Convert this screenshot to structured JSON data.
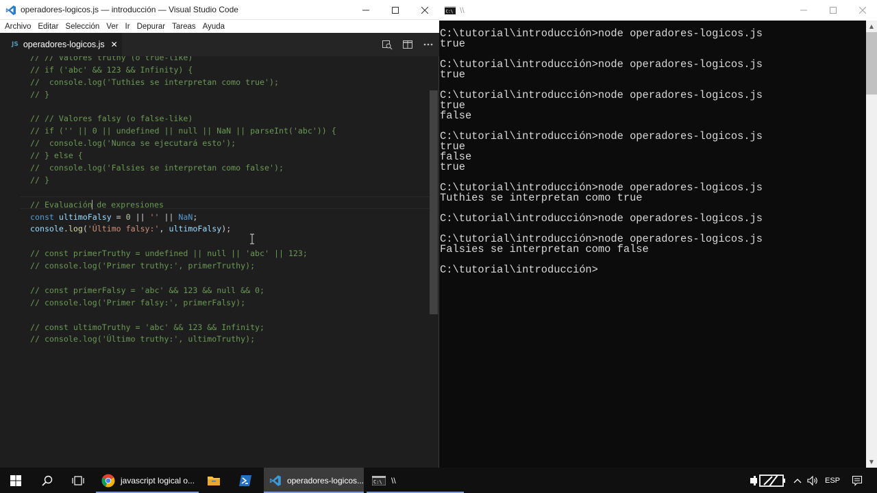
{
  "vscode": {
    "title": "operadores-logicos.js — introducción — Visual Studio Code",
    "menu": [
      "Archivo",
      "Editar",
      "Selección",
      "Ver",
      "Ir",
      "Depurar",
      "Tareas",
      "Ayuda"
    ],
    "tab": {
      "lang": "JS",
      "label": "operadores-logicos.js",
      "close": "✕"
    },
    "code": [
      {
        "t": [
          [
            "cm",
            "// // Valores truthy (o true-like)"
          ]
        ]
      },
      {
        "t": [
          [
            "cm",
            "// if ('abc' && 123 && Infinity) {"
          ]
        ]
      },
      {
        "t": [
          [
            "cm",
            "//  console.log('Tuthies se interpretan como true');"
          ]
        ]
      },
      {
        "t": [
          [
            "cm",
            "// }"
          ]
        ]
      },
      {
        "t": []
      },
      {
        "t": [
          [
            "cm",
            "// // Valores falsy (o false-like)"
          ]
        ]
      },
      {
        "t": [
          [
            "cm",
            "// if ('' || 0 || undefined || null || NaN || parseInt('abc')) {"
          ]
        ]
      },
      {
        "t": [
          [
            "cm",
            "//  console.log('Nunca se ejecutará esto');"
          ]
        ]
      },
      {
        "t": [
          [
            "cm",
            "// } else {"
          ]
        ]
      },
      {
        "t": [
          [
            "cm",
            "//  console.log('Falsies se interpretan como false');"
          ]
        ]
      },
      {
        "t": [
          [
            "cm",
            "// }"
          ]
        ]
      },
      {
        "t": []
      },
      {
        "t": [
          [
            "cm",
            "// Evaluación"
          ],
          [
            "cursor",
            ""
          ],
          [
            "cm",
            " de expresiones"
          ]
        ]
      },
      {
        "t": [
          [
            "kw",
            "const"
          ],
          [
            "pl",
            " "
          ],
          [
            "vr",
            "ultimoFalsy"
          ],
          [
            "pl",
            " = "
          ],
          [
            "nm",
            "0"
          ],
          [
            "pl",
            " || "
          ],
          [
            "st",
            "''"
          ],
          [
            "pl",
            " || "
          ],
          [
            "kw",
            "NaN"
          ],
          [
            "pl",
            ";"
          ]
        ]
      },
      {
        "t": [
          [
            "vr",
            "console"
          ],
          [
            "pl",
            "."
          ],
          [
            "fn",
            "log"
          ],
          [
            "pl",
            "("
          ],
          [
            "st",
            "'Último falsy:'"
          ],
          [
            "pl",
            ", "
          ],
          [
            "vr",
            "ultimoFalsy"
          ],
          [
            "pl",
            ");"
          ]
        ]
      },
      {
        "t": []
      },
      {
        "t": [
          [
            "cm",
            "// const primerTruthy = undefined || null || 'abc' || 123;"
          ]
        ]
      },
      {
        "t": [
          [
            "cm",
            "// console.log('Primer truthy:', primerTruthy);"
          ]
        ]
      },
      {
        "t": []
      },
      {
        "t": [
          [
            "cm",
            "// const primerFalsy = 'abc' && 123 && null && 0;"
          ]
        ]
      },
      {
        "t": [
          [
            "cm",
            "// console.log('Primer falsy:', primerFalsy);"
          ]
        ]
      },
      {
        "t": []
      },
      {
        "t": [
          [
            "cm",
            "// const ultimoTruthy = 'abc' && 123 && Infinity;"
          ]
        ]
      },
      {
        "t": [
          [
            "cm",
            "// console.log('Último truthy:', ultimoTruthy);"
          ]
        ]
      }
    ],
    "colors": {
      "background": "#1e1e1e",
      "comment": "#6a9955",
      "keyword": "#569cd6",
      "variable": "#9cdcfe",
      "string": "#ce9178",
      "function": "#dcdcaa",
      "number": "#b5cea8"
    }
  },
  "console": {
    "title": "\\\\",
    "lines": [
      "C:\\tutorial\\introducción>node operadores-logicos.js",
      "true",
      "",
      "C:\\tutorial\\introducción>node operadores-logicos.js",
      "true",
      "",
      "C:\\tutorial\\introducción>node operadores-logicos.js",
      "true",
      "false",
      "",
      "C:\\tutorial\\introducción>node operadores-logicos.js",
      "true",
      "false",
      "true",
      "",
      "C:\\tutorial\\introducción>node operadores-logicos.js",
      "Tuthies se interpretan como true",
      "",
      "C:\\tutorial\\introducción>node operadores-logicos.js",
      "",
      "C:\\tutorial\\introducción>node operadores-logicos.js",
      "Falsies se interpretan como false",
      "",
      "C:\\tutorial\\introducción>"
    ]
  },
  "taskbar": {
    "apps": [
      {
        "label": "javascript logical o...",
        "icon": "chrome-icon"
      },
      {
        "label": "",
        "icon": "file-explorer-icon"
      },
      {
        "label": "",
        "icon": "powershell-icon"
      },
      {
        "label": "operadores-logicos...",
        "icon": "vscode-icon"
      },
      {
        "label": "\\\\",
        "icon": "cmd-icon"
      }
    ],
    "language": "ESP"
  }
}
